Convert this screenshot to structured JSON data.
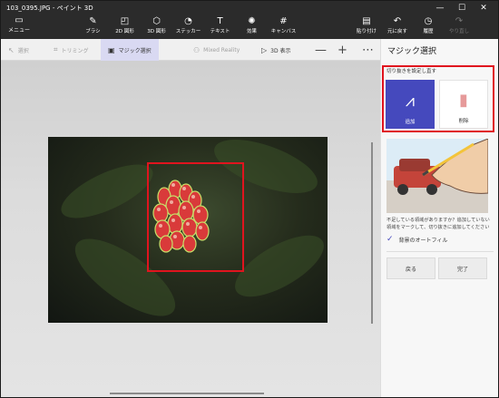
{
  "window": {
    "title": "103_0395.JPG - ペイント 3D"
  },
  "window_controls": {
    "minimize": "—",
    "maximize": "☐",
    "close": "✕"
  },
  "menu": {
    "label": "メニュー"
  },
  "ribbon": {
    "tools": [
      {
        "name": "brushes",
        "label": "ブラシ",
        "icon": "brush-icon"
      },
      {
        "name": "2d-shapes",
        "label": "2D 図形",
        "icon": "shapes-2d-icon"
      },
      {
        "name": "3d-shapes",
        "label": "3D 図形",
        "icon": "cube-icon"
      },
      {
        "name": "stickers",
        "label": "ステッカー",
        "icon": "sticker-icon"
      },
      {
        "name": "text",
        "label": "テキスト",
        "icon": "text-icon"
      },
      {
        "name": "effects",
        "label": "効果",
        "icon": "effects-icon"
      },
      {
        "name": "canvas",
        "label": "キャンバス",
        "icon": "canvas-icon"
      }
    ],
    "right_tools": [
      {
        "name": "paste",
        "label": "貼り付け",
        "icon": "paste-icon"
      },
      {
        "name": "undo",
        "label": "元に戻す",
        "icon": "undo-icon"
      },
      {
        "name": "history",
        "label": "履歴",
        "icon": "history-icon"
      },
      {
        "name": "redo",
        "label": "やり直し",
        "icon": "redo-icon"
      }
    ]
  },
  "toolbar": {
    "select": "選択",
    "crop": "トリミング",
    "magic_select": "マジック選択",
    "mixed_reality": "Mixed Reality",
    "view_3d": "3D 表示",
    "zoom_out": "—",
    "zoom_in": "+",
    "more": "⋯"
  },
  "panel": {
    "title": "マジック選択",
    "refine_label": "切り抜きを設定し直す",
    "add_label": "追加",
    "remove_label": "削除",
    "hint": "不足している領域がありますか？追加していない領域をマークして、切り抜きに追加してください",
    "autofill_label": "背景のオートフィル",
    "back_label": "戻る",
    "done_label": "完了"
  },
  "colors": {
    "accent": "#4549bd",
    "highlight": "#e0141e",
    "titlebar": "#2b2b2b"
  }
}
